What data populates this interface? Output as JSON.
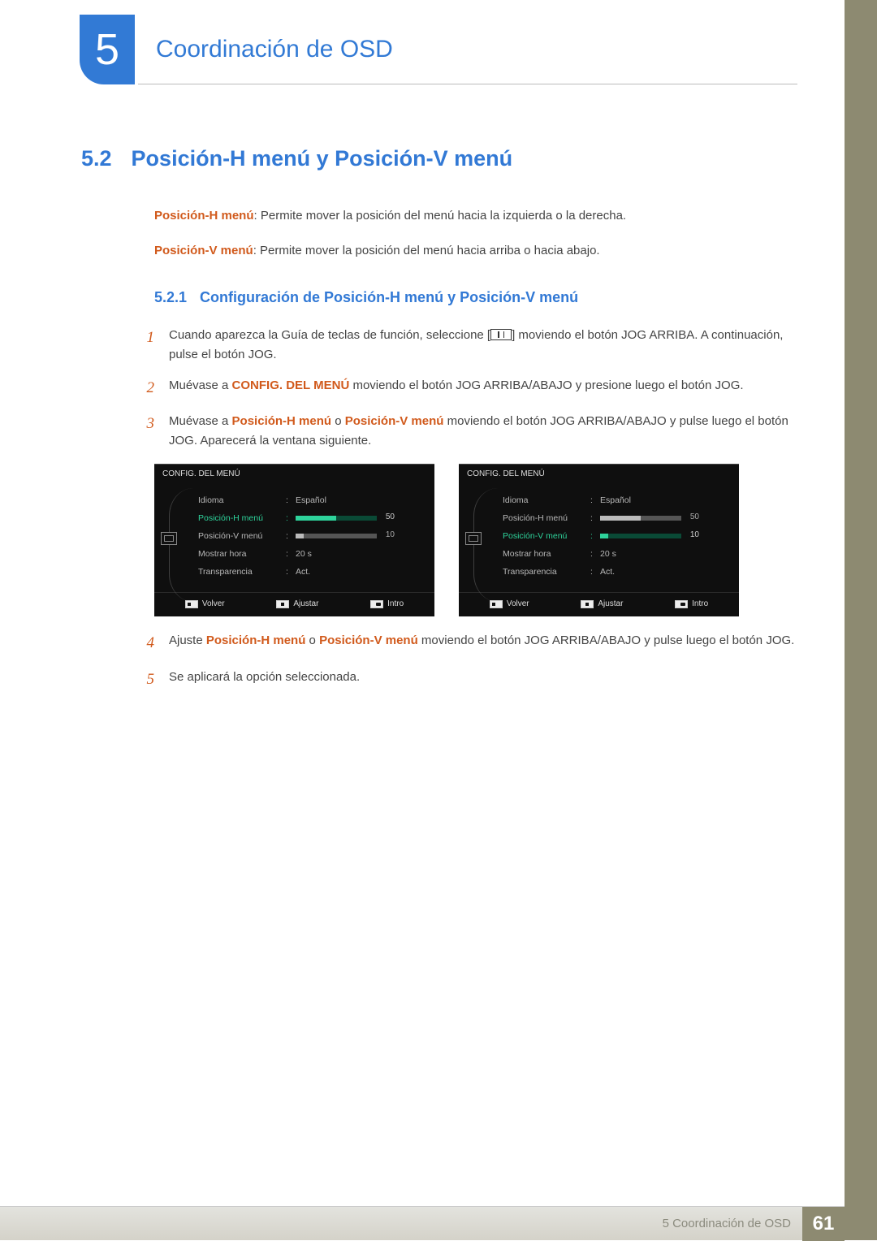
{
  "chapter": {
    "number": "5",
    "title": "Coordinación de OSD"
  },
  "section": {
    "number": "5.2",
    "title": "Posición-H menú y Posición-V menú"
  },
  "intro": {
    "p1_key": "Posición-H menú",
    "p1_rest": ": Permite mover la posición del menú hacia la izquierda o la derecha.",
    "p2_key": "Posición-V menú",
    "p2_rest": ": Permite mover la posición del menú hacia arriba o hacia abajo."
  },
  "subsection": {
    "number": "5.2.1",
    "title": "Configuración de Posición-H menú y Posición-V menú"
  },
  "steps": {
    "s1a": "Cuando aparezca la Guía de teclas de función, seleccione [",
    "s1b": "] moviendo el botón JOG ARRIBA. A continuación, pulse el botón JOG.",
    "s2a": "Muévase a ",
    "s2key": "CONFIG. DEL MENÚ",
    "s2b": " moviendo el botón JOG ARRIBA/ABAJO y presione luego el botón JOG.",
    "s3a": "Muévase a ",
    "s3k1": "Posición-H menú",
    "s3mid": " o ",
    "s3k2": "Posición-V menú",
    "s3b": " moviendo el botón JOG ARRIBA/ABAJO y pulse luego el botón JOG. Aparecerá la ventana siguiente.",
    "s4a": "Ajuste ",
    "s4k1": "Posición-H menú",
    "s4mid": " o ",
    "s4k2": "Posición-V menú",
    "s4b": " moviendo el botón JOG ARRIBA/ABAJO y pulse luego el botón JOG.",
    "s5": "Se aplicará la opción seleccionada."
  },
  "osd": {
    "title": "CONFIG. DEL MENÚ",
    "labels": {
      "idioma": "Idioma",
      "posH": "Posición-H menú",
      "posV": "Posición-V menú",
      "mostrar": "Mostrar hora",
      "trans": "Transparencia"
    },
    "values": {
      "idioma": "Español",
      "mostrar": "20 s",
      "trans": "Act.",
      "posH_val": "50",
      "posV_val": "10"
    },
    "footer": {
      "volver": "Volver",
      "ajustar": "Ajustar",
      "intro": "Intro"
    }
  },
  "footer": {
    "label": "5 Coordinación de OSD",
    "page": "61"
  }
}
